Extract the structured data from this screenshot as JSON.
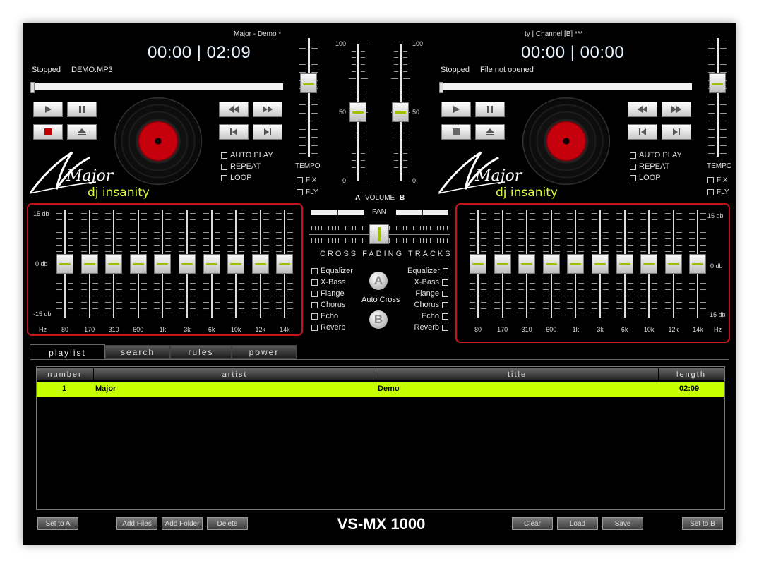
{
  "app_title": "VS-MX 1000",
  "deck_a": {
    "track_title": "Major - Demo *",
    "time": "00:00 | 02:09",
    "status": "Stopped",
    "file": "DEMO.MP3",
    "progress": 0.0,
    "options": [
      "AUTO PLAY",
      "REPEAT",
      "LOOP"
    ],
    "logo_text": "Major",
    "logo_sub": "dj insanity"
  },
  "deck_b": {
    "track_title": "ty | Channel [B] ***",
    "time": "00:00 | 00:00",
    "status": "Stopped",
    "file": "File not opened",
    "progress": 0.0,
    "options": [
      "AUTO PLAY",
      "REPEAT",
      "LOOP"
    ],
    "logo_text": "Major",
    "logo_sub": "dj insanity"
  },
  "tempo": {
    "label": "TEMPO",
    "fix": "FIX",
    "fly": "FLY"
  },
  "volume": {
    "label": "VOLUME",
    "a_label": "A",
    "b_label": "B",
    "scale_top": "100",
    "scale_mid": "50",
    "scale_bottom": "0",
    "level_a": 50,
    "level_b": 50
  },
  "pan": {
    "label": "PAN"
  },
  "crossfade": {
    "label": "CROSS FADING TRACKS",
    "position": 0.5
  },
  "effects": [
    "Equalizer",
    "X-Bass",
    "Flange",
    "Chorus",
    "Echo",
    "Reverb"
  ],
  "auto_cross": {
    "label": "Auto Cross",
    "a": "A",
    "b": "B"
  },
  "eq": {
    "db_top": "15 db",
    "db_mid": "0 db",
    "db_bottom": "-15 db",
    "hz": "Hz",
    "bands": [
      "80",
      "170",
      "310",
      "600",
      "1k",
      "3k",
      "6k",
      "10k",
      "12k",
      "14k"
    ],
    "levels_db": [
      0,
      0,
      0,
      0,
      0,
      0,
      0,
      0,
      0,
      0
    ]
  },
  "tabs": [
    "playlist",
    "search",
    "rules",
    "power"
  ],
  "active_tab": "playlist",
  "playlist": {
    "columns": [
      "number",
      "artist",
      "title",
      "length"
    ],
    "rows": [
      {
        "number": "1",
        "artist": "Major",
        "title": "Demo",
        "length": "02:09"
      }
    ]
  },
  "buttons": {
    "set_to_a": "Set to A",
    "add_files": "Add Files",
    "add_folder": "Add Folder",
    "delete": "Delete",
    "clear": "Clear",
    "load": "Load",
    "save": "Save",
    "set_to_b": "Set to B"
  },
  "colors": {
    "accent_green": "#c6ff00",
    "eq_border": "#c4141c",
    "record_red": "#c7000e"
  }
}
